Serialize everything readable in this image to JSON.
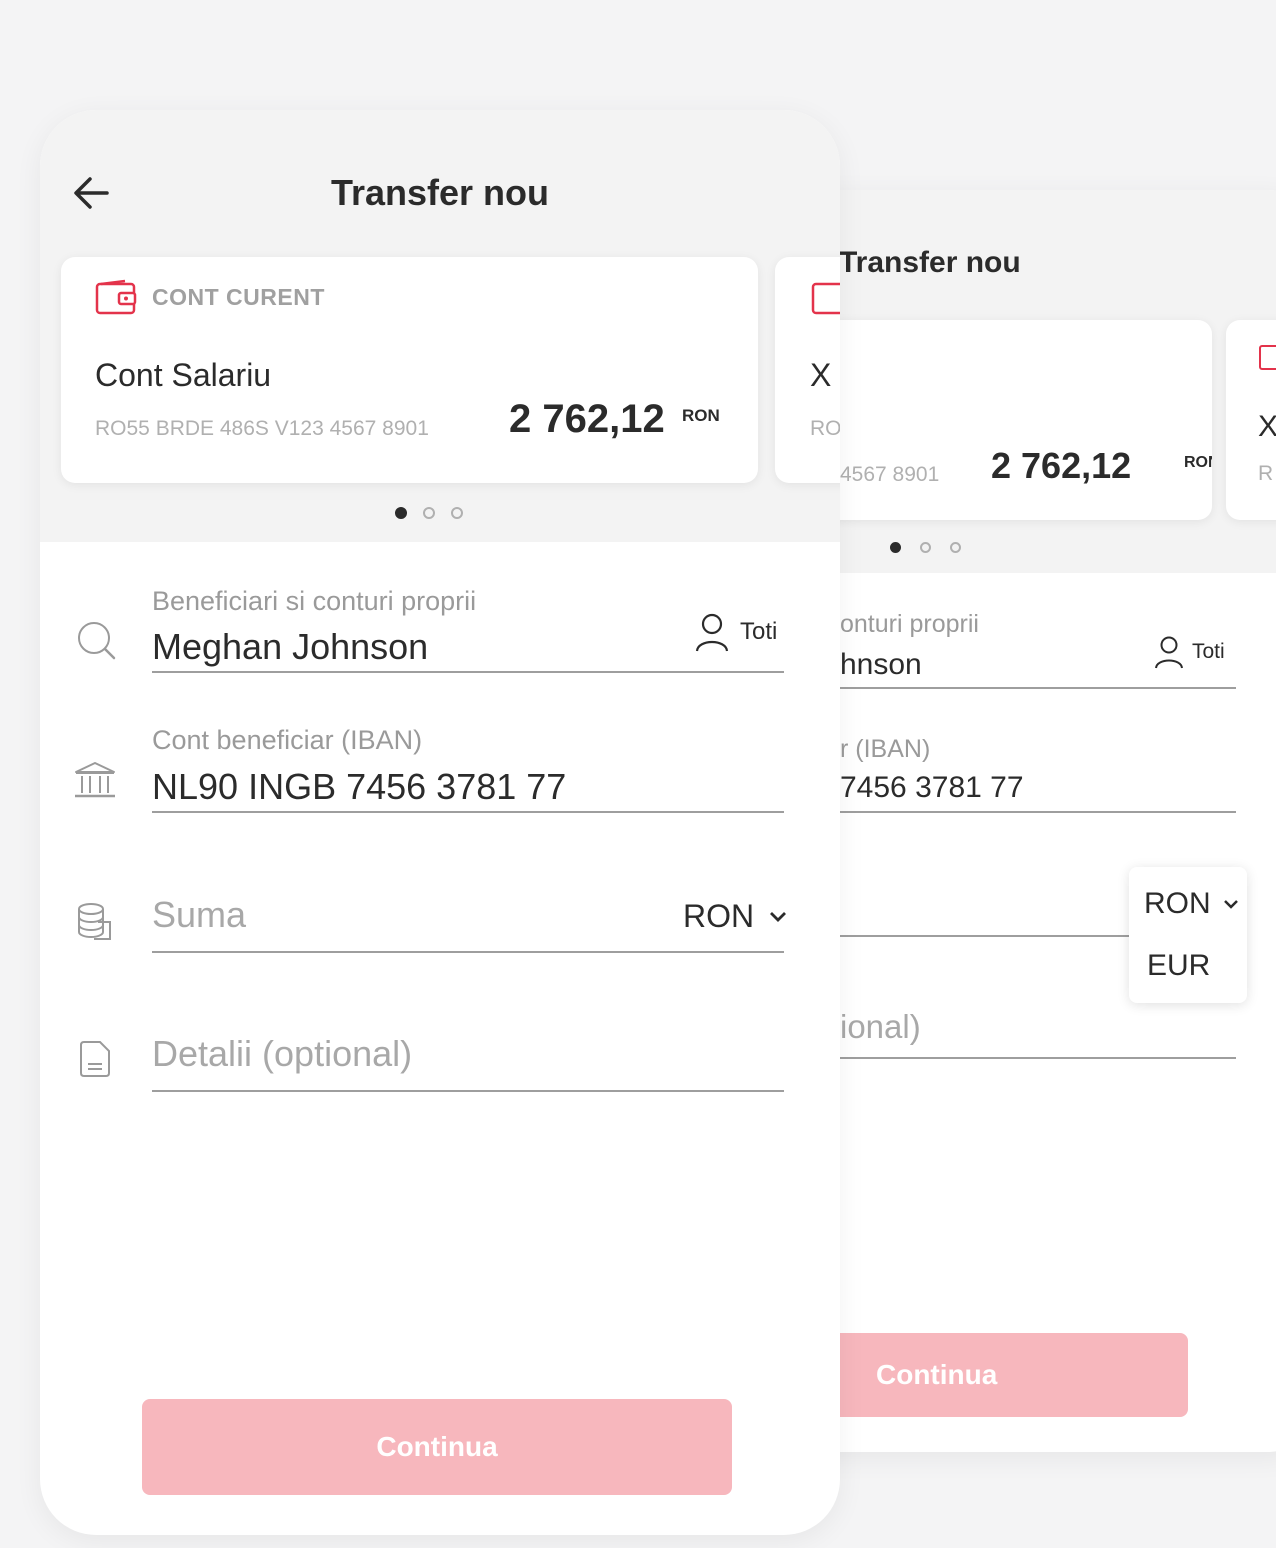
{
  "screen_main": {
    "title": "Transfer nou",
    "cards": [
      {
        "type_label": "CONT CURENT",
        "name": "Cont Salariu",
        "iban": "RO55 BRDE 486S V123 4567 8901",
        "balance": "2 762,12",
        "currency": "RON"
      },
      {
        "name_fragment": "X",
        "iban_fragment": "RO"
      }
    ],
    "carousel": {
      "active_index": 0,
      "count": 3
    },
    "beneficiary": {
      "label": "Beneficiari si conturi proprii",
      "value": "Meghan Johnson",
      "filter_label": "Toti"
    },
    "iban_field": {
      "label": "Cont beneficiar (IBAN)",
      "value": "NL90 INGB 7456 3781 77"
    },
    "amount": {
      "placeholder": "Suma",
      "currency": "RON"
    },
    "details": {
      "placeholder": "Detalii (optional)"
    },
    "continue_label": "Continua"
  },
  "screen_dropdown": {
    "title": "Transfer nou",
    "card": {
      "iban_fragment": "4567 8901",
      "balance": "2 762,12",
      "currency": "RON"
    },
    "next_card": {
      "name_fragment": "X",
      "iban_fragment": "R"
    },
    "carousel": {
      "active_index": 0,
      "count": 3
    },
    "beneficiary": {
      "label_fragment": "onturi proprii",
      "value_fragment": "hnson",
      "filter_label": "Toti"
    },
    "iban_field": {
      "label_fragment": "r (IBAN)",
      "value_fragment": "7456 3781 77"
    },
    "currency_options": [
      "RON",
      "EUR"
    ],
    "details_fragment": "ional)",
    "continue_label": "Continua"
  },
  "colors": {
    "accent": "#e3334b",
    "button_disabled": "#f7b7bd",
    "background": "#f4f4f5",
    "text": "#2b2b2b",
    "muted_text": "#a0a0a0"
  },
  "icons": [
    "back-arrow-icon",
    "wallet-icon",
    "search-icon",
    "bank-icon",
    "coins-icon",
    "document-icon",
    "user-icon",
    "chevron-down-icon"
  ]
}
